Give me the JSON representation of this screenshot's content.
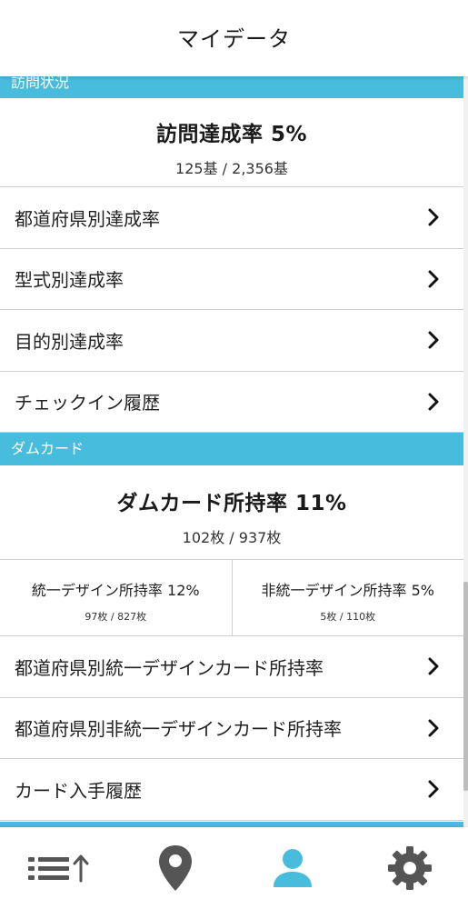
{
  "header": {
    "title": "マイデータ"
  },
  "visit": {
    "section_label": "訪問状況",
    "summary_title": "訪問達成率 5%",
    "summary_sub": "125基 / 2,356基",
    "rows": [
      {
        "label": "都道府県別達成率"
      },
      {
        "label": "型式別達成率"
      },
      {
        "label": "目的別達成率"
      },
      {
        "label": "チェックイン履歴"
      }
    ]
  },
  "damcard": {
    "section_label": "ダムカード",
    "summary_title": "ダムカード所持率 11%",
    "summary_sub": "102枚 / 937枚",
    "unified": {
      "title": "統一デザイン所持率 12%",
      "sub": "97枚 / 827枚"
    },
    "nonunified": {
      "title": "非統一デザイン所持率 5%",
      "sub": "5枚 / 110枚"
    },
    "rows": [
      {
        "label": "都道府県別統一デザインカード所持率"
      },
      {
        "label": "都道府県別非統一デザインカード所持率"
      },
      {
        "label": "カード入手履歴"
      }
    ]
  },
  "tabbar": {
    "tabs": [
      {
        "icon": "sorted-list-icon",
        "active": false
      },
      {
        "icon": "map-pin-icon",
        "active": false
      },
      {
        "icon": "user-icon",
        "active": true
      },
      {
        "icon": "gear-icon",
        "active": false
      }
    ]
  },
  "colors": {
    "accent": "#48bcdc",
    "icon_inactive": "#555555"
  }
}
